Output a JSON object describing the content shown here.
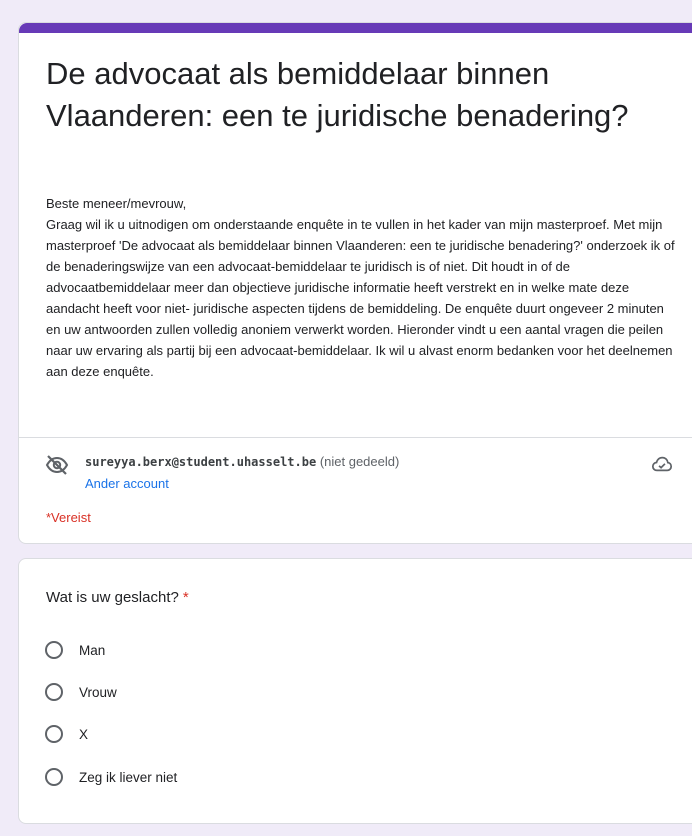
{
  "form": {
    "title": "De advocaat als bemiddelaar binnen Vlaanderen: een te juridische benadering?",
    "description": "Beste meneer/mevrouw,\nGraag wil ik u uitnodigen om onderstaande enquête in te vullen in het kader van mijn masterproef. Met mijn masterproef 'De advocaat als bemiddelaar binnen Vlaanderen: een te juridische benadering?' onderzoek ik of de benaderingswijze van een advocaat-bemiddelaar te juridisch is of niet. Dit houdt in of de advocaatbemiddelaar meer dan objectieve juridische informatie heeft verstrekt en in welke mate deze aandacht heeft voor niet- juridische aspecten tijdens de bemiddeling. De enquête duurt ongeveer 2 minuten en uw antwoorden zullen volledig anoniem verwerkt worden. Hieronder vindt u een aantal vragen die peilen naar uw ervaring als partij bij een advocaat-bemiddelaar. Ik wil u alvast enorm bedanken voor het deelnemen aan deze enquête.",
    "accent_color": "#673ab7"
  },
  "account": {
    "email": "sureyya.berx@student.uhasselt.be",
    "shared_status": "(niet gedeeld)",
    "switch_label": "Ander account",
    "icons": {
      "left": "eye-off-icon",
      "right": "cloud-check-icon"
    }
  },
  "required_note": "*Vereist",
  "question": {
    "title": "Wat is uw geslacht?",
    "required_mark": "*",
    "options": [
      "Man",
      "Vrouw",
      "X",
      "Zeg ik liever niet"
    ]
  }
}
